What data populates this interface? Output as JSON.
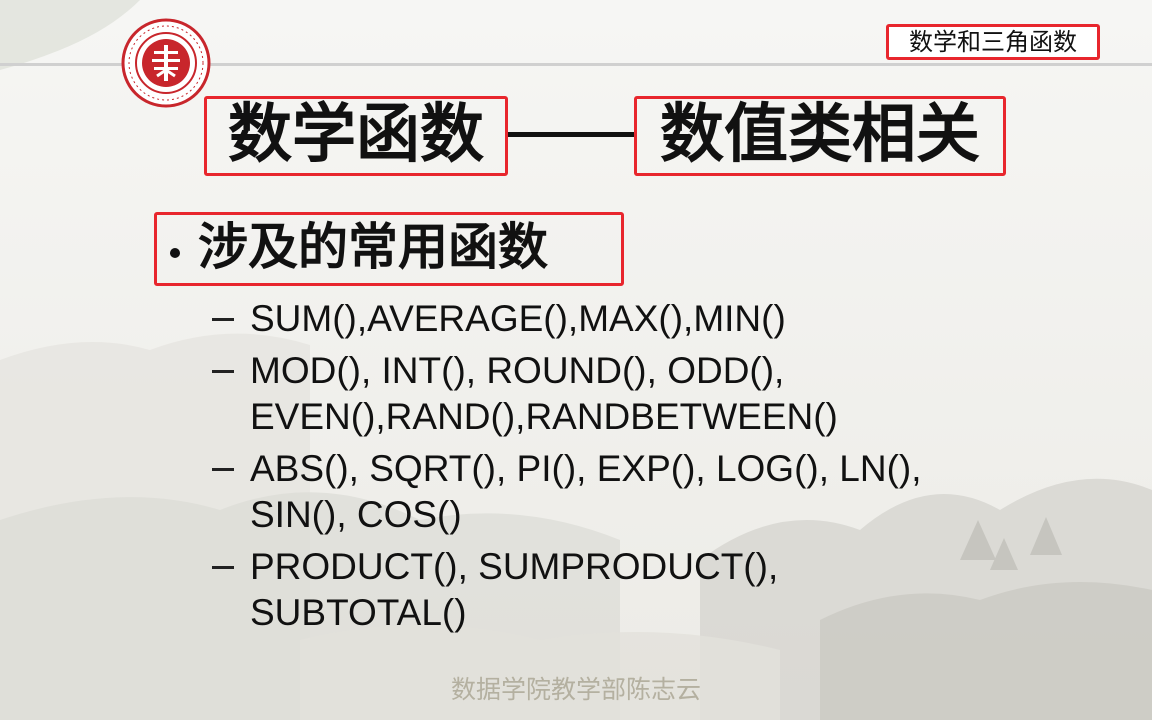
{
  "header": {
    "section_tag": "数学和三角函数",
    "logo": {
      "icon": "university-seal-icon",
      "color": "#c8262c"
    }
  },
  "slide": {
    "title_left": "数学函数",
    "title_right": "数值类相关",
    "bullet": "涉及的常用函数",
    "sub_items": [
      {
        "lines": [
          "SUM(),AVERAGE(),MAX(),MIN()"
        ]
      },
      {
        "lines": [
          "MOD(), INT(), ROUND(), ODD(),",
          "EVEN(),RAND(),RANDBETWEEN()"
        ]
      },
      {
        "lines": [
          "ABS(), SQRT(), PI(),  EXP(), LOG(), LN(),",
          "SIN(), COS()"
        ]
      },
      {
        "lines": [
          "PRODUCT(), SUMPRODUCT(),",
          "SUBTOTAL()"
        ]
      }
    ]
  },
  "footer": {
    "author": "数据学院教学部陈志云"
  },
  "colors": {
    "highlight": "#e8262d",
    "text": "#111111",
    "footer_text": "#b4b0a0"
  }
}
